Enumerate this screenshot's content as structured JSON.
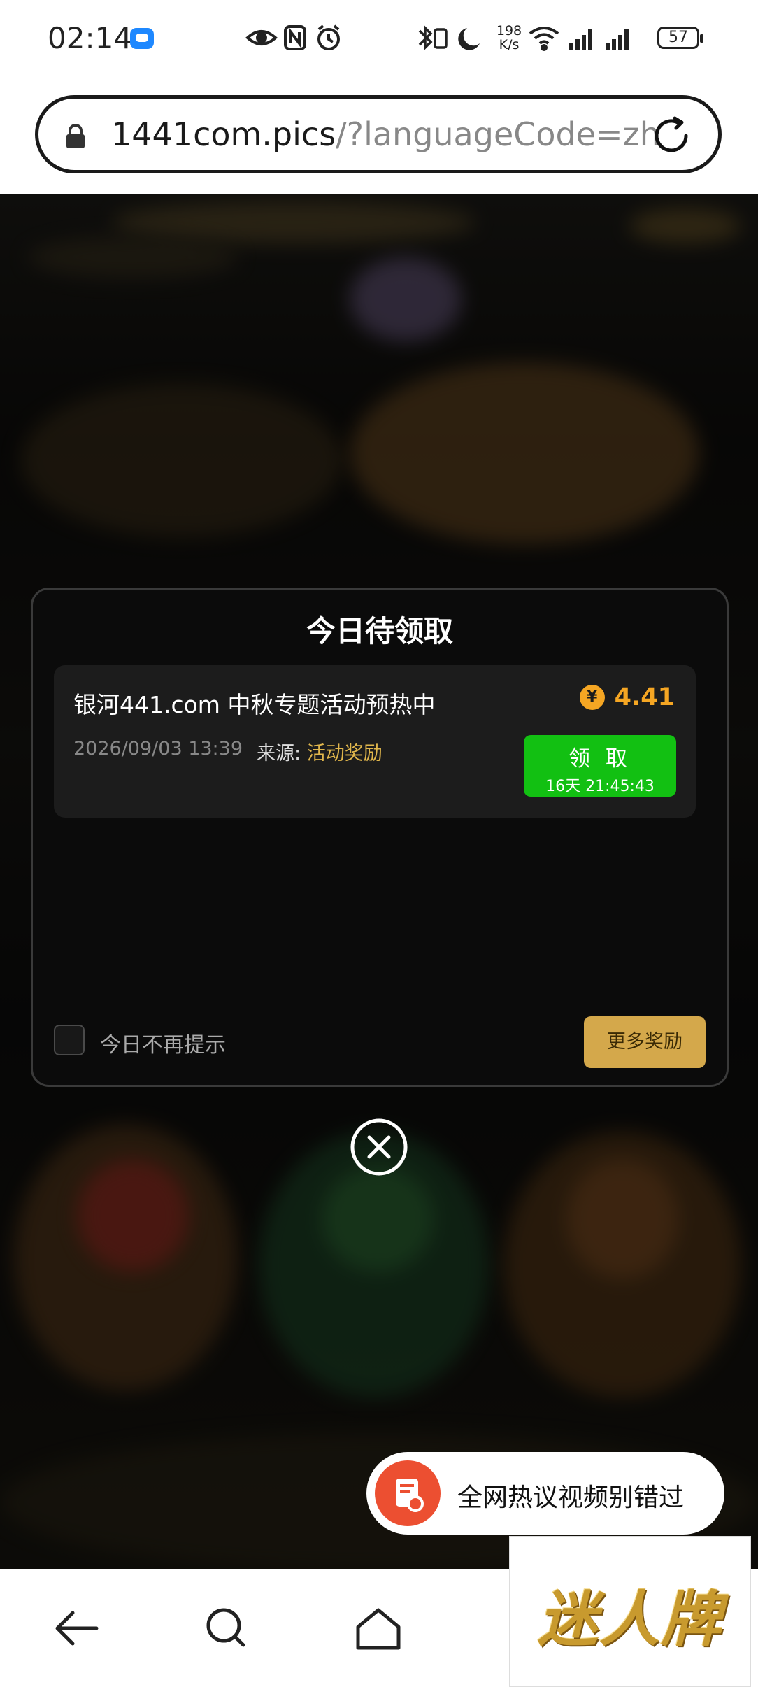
{
  "status_bar": {
    "time": "02:14",
    "net_speed_value": "198",
    "net_speed_unit": "K/s",
    "battery": "57"
  },
  "browser": {
    "url_host": "1441com.pics",
    "url_path": "/?languageCode=zh"
  },
  "dialog": {
    "title": "今日待领取",
    "reward_card": {
      "title": "银河441.com 中秋专题活动预热中",
      "currency_symbol": "¥",
      "amount": "4.41",
      "date": "2026/09/03 13:39",
      "source_label": "来源:",
      "source_value": "活动奖励",
      "claim_label": "领 取",
      "claim_timer": "16天 21:45:43"
    },
    "dont_show_label": "今日不再提示",
    "more_rewards_label": "更多奖励"
  },
  "toast": {
    "text": "全网热议视频别错过"
  },
  "promo": {
    "text": "迷人牌"
  },
  "colors": {
    "claim_green": "#12c012",
    "amount_orange": "#f5a623",
    "more_gold": "#d4a84b",
    "toast_icon_red": "#ec4f31"
  }
}
